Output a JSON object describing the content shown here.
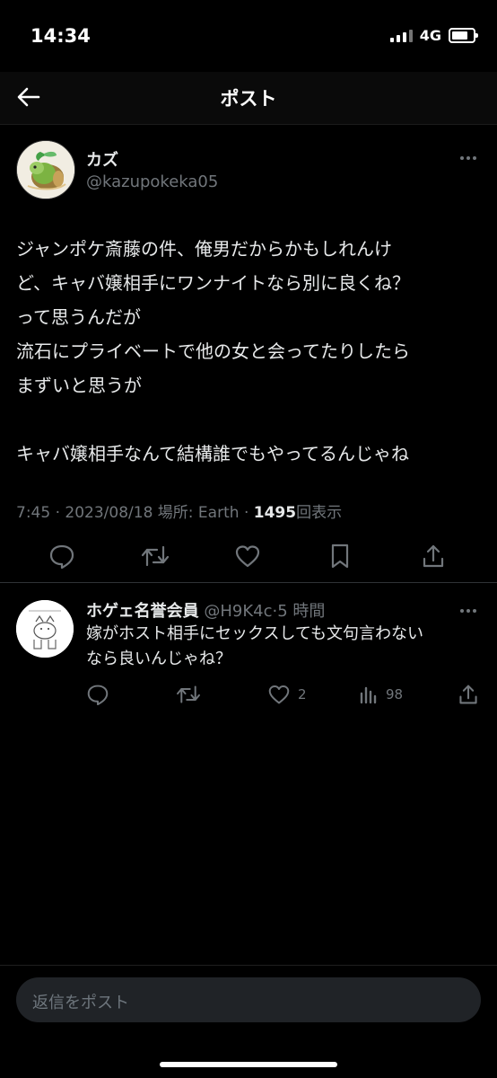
{
  "status_bar": {
    "time": "14:34",
    "network": "4G"
  },
  "header": {
    "title": "ポスト"
  },
  "tweet": {
    "author_name": "カズ",
    "author_handle": "@kazupokeka05",
    "text": "ジャンポケ斎藤の件、俺男だからかもしれんけ\nど、キャバ嬢相手にワンナイトなら別に良くね？\nって思うんだが\n流石にプライベートで他の女と会ってたりしたら\nまずいと思うが\n\nキャバ嬢相手なんて結構誰でもやってるんじゃね",
    "time": "7:45",
    "sep": "·",
    "date": "2023/08/18",
    "location": "場所: Earth",
    "views_count": "1495",
    "views_label": "回表示"
  },
  "reply": {
    "author_name": "ホゲェ名誉会員",
    "author_handle": "@H9K4c",
    "time_ago": "5 時間",
    "text": "嫁がホスト相手にセックスしても文句言わない\nなら良いんじゃね？",
    "likes": "2",
    "views": "98"
  },
  "composer": {
    "placeholder": "返信をポスト"
  },
  "icons": {
    "back": "arrow-left-icon",
    "more": "more-dots-icon",
    "reply": "reply-bubble-icon",
    "repost": "repost-arrows-icon",
    "like": "heart-icon",
    "bookmark": "bookmark-icon",
    "share": "share-upload-icon",
    "views": "bar-chart-icon"
  },
  "colors": {
    "background": "#000000",
    "text": "#e7e9ea",
    "muted": "#71767b",
    "divider": "#2f3336"
  }
}
